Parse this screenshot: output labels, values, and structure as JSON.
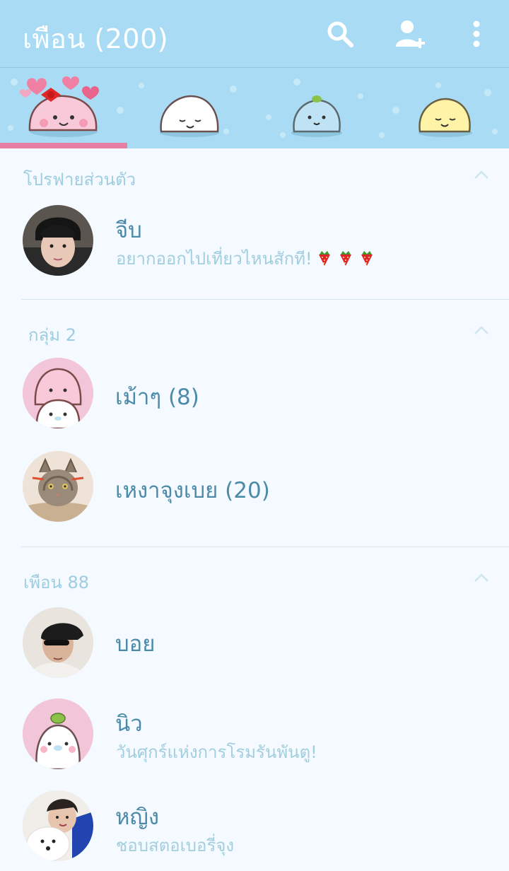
{
  "header": {
    "title": "เพือน (200)",
    "icons": [
      "search-icon",
      "add-friend-icon",
      "more-icon"
    ]
  },
  "tabs": [
    {
      "name": "pink-seal-tab",
      "active": true
    },
    {
      "name": "white-seal-tab",
      "active": false
    },
    {
      "name": "blue-seal-tab",
      "active": false
    },
    {
      "name": "yellow-seal-tab",
      "active": false
    }
  ],
  "colors": {
    "header_bg": "#a9dcf4",
    "accent_pink": "#e77fa2",
    "name_text": "#4b8aa8",
    "section_text": "#9fcde0",
    "background": "#f4faff"
  },
  "sections": {
    "profile": {
      "label": "โปรฟายส่วนตัว",
      "items": [
        {
          "name": "จีบ",
          "status": "อยากออกไปเที่ยวไหนสักที!",
          "status_emoji": "strawberry x3"
        }
      ]
    },
    "groups": {
      "label": "กลุ่ม 2",
      "items": [
        {
          "name": "เม้าๆ (8)"
        },
        {
          "name": "เหงาจุงเบย (20)"
        }
      ]
    },
    "friends": {
      "label": "เพือน 88",
      "items": [
        {
          "name": "บอย"
        },
        {
          "name": "นิว",
          "status": "วันศุกร์แห่งการโรมรันพันตู!"
        },
        {
          "name": "หญิง",
          "status": "ชอบสตอเบอรี่จุง"
        }
      ]
    }
  }
}
